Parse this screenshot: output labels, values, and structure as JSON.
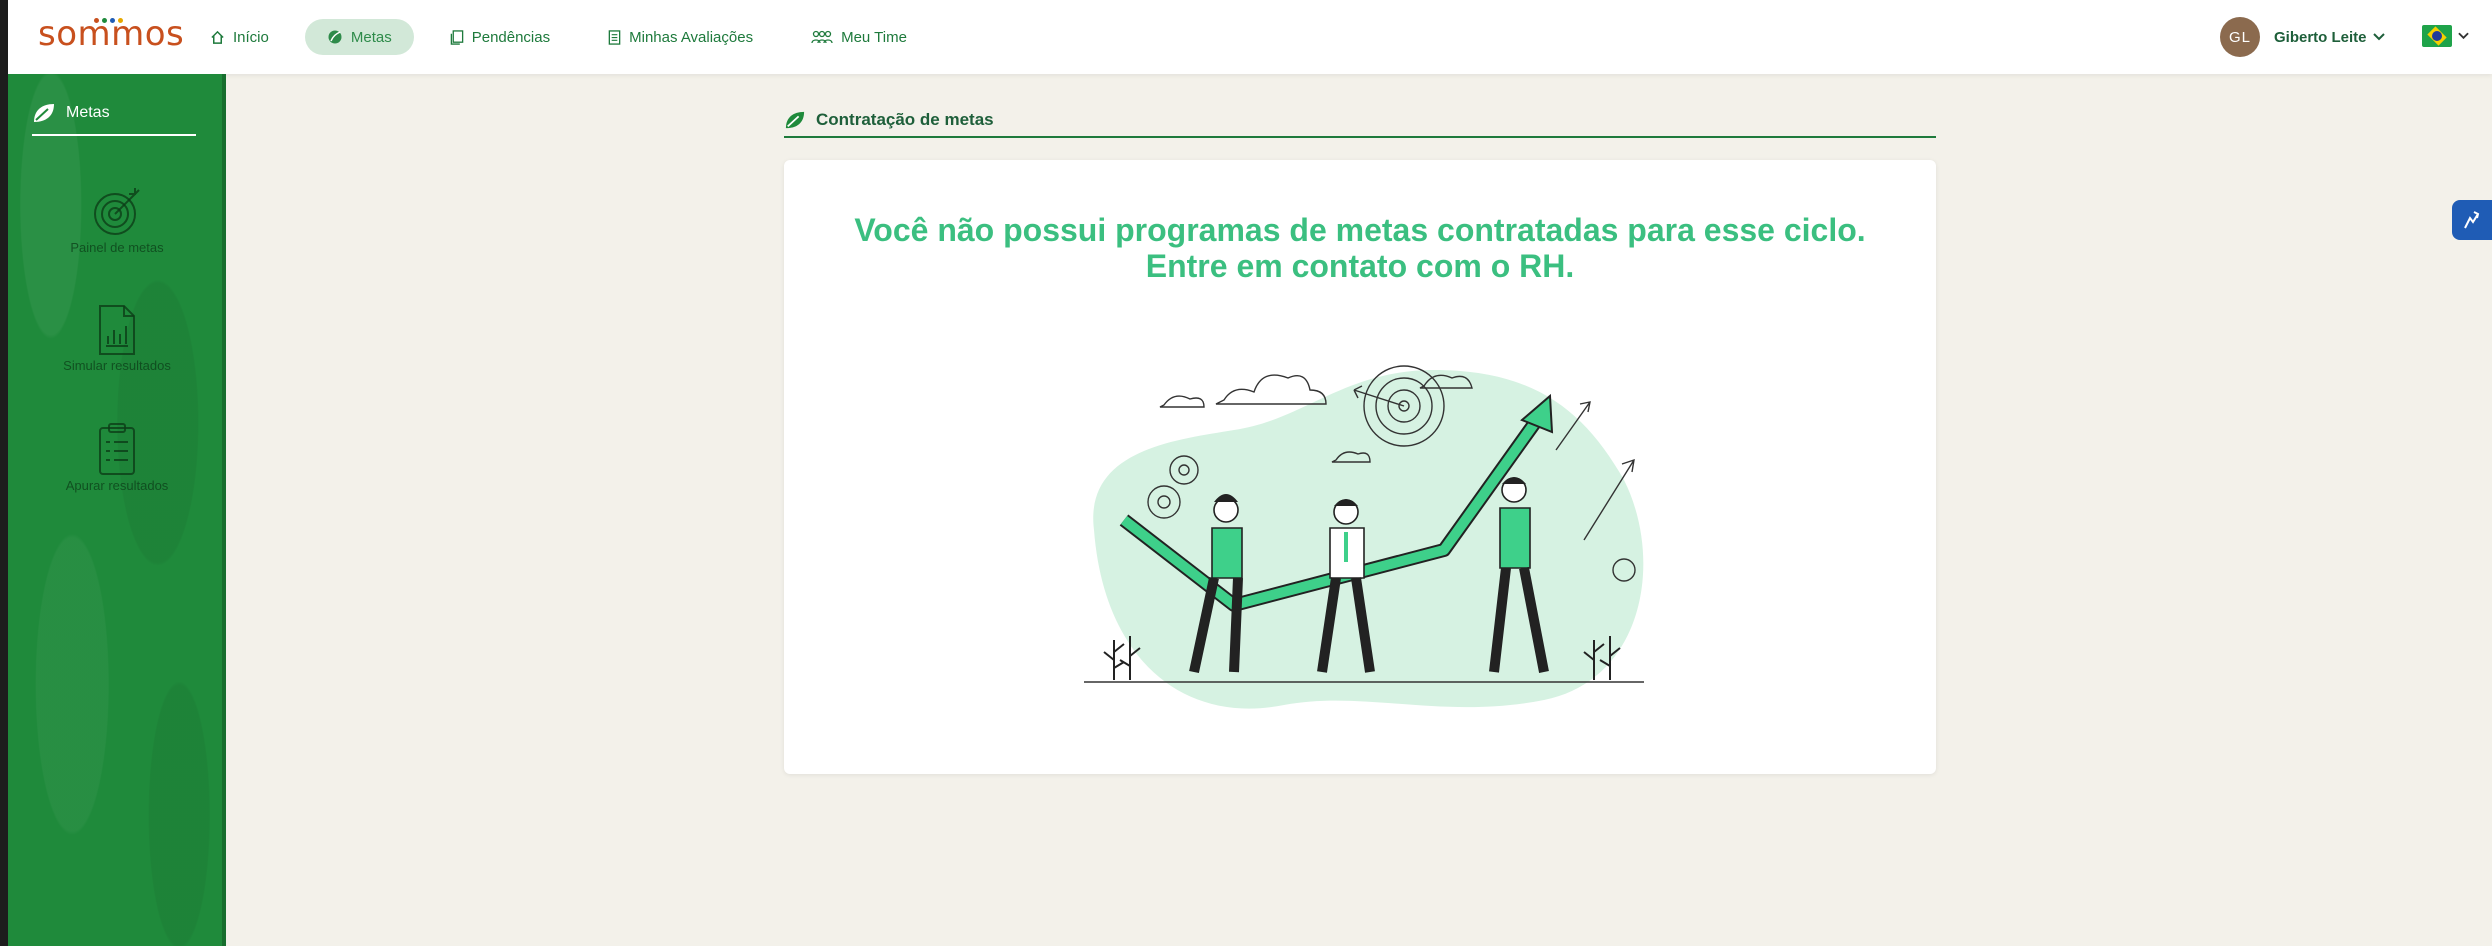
{
  "brand": {
    "logo_text": "sommos",
    "dot_colors": [
      "#c8501e",
      "#1f8a3b",
      "#1f5cb5",
      "#e6a800"
    ]
  },
  "nav": {
    "items": [
      {
        "label": "Início",
        "icon": "home-icon",
        "active": false
      },
      {
        "label": "Metas",
        "icon": "leaf-target-icon",
        "active": true
      },
      {
        "label": "Pendências",
        "icon": "documents-icon",
        "active": false
      },
      {
        "label": "Minhas Avaliações",
        "icon": "clipboard-icon",
        "active": false
      },
      {
        "label": "Meu Time",
        "icon": "team-icon",
        "active": false
      }
    ]
  },
  "user": {
    "initials": "GL",
    "name": "Giberto Leite",
    "locale": "pt-BR"
  },
  "sidebar": {
    "title": "Metas",
    "items": [
      {
        "label": "Painel de metas",
        "icon": "target-icon"
      },
      {
        "label": "Simular resultados",
        "icon": "chart-document-icon"
      },
      {
        "label": "Apurar resultados",
        "icon": "clipboard-list-icon"
      }
    ]
  },
  "main": {
    "section_title": "Contratação de metas",
    "empty_message": "Você não possui programas de metas contratadas para esse ciclo. Entre em contato com o RH."
  },
  "colors": {
    "primary_green": "#1f8a3b",
    "accent_green": "#3bbf80",
    "text_dark_green": "#1e5f3a",
    "background": "#f3f1ea"
  }
}
